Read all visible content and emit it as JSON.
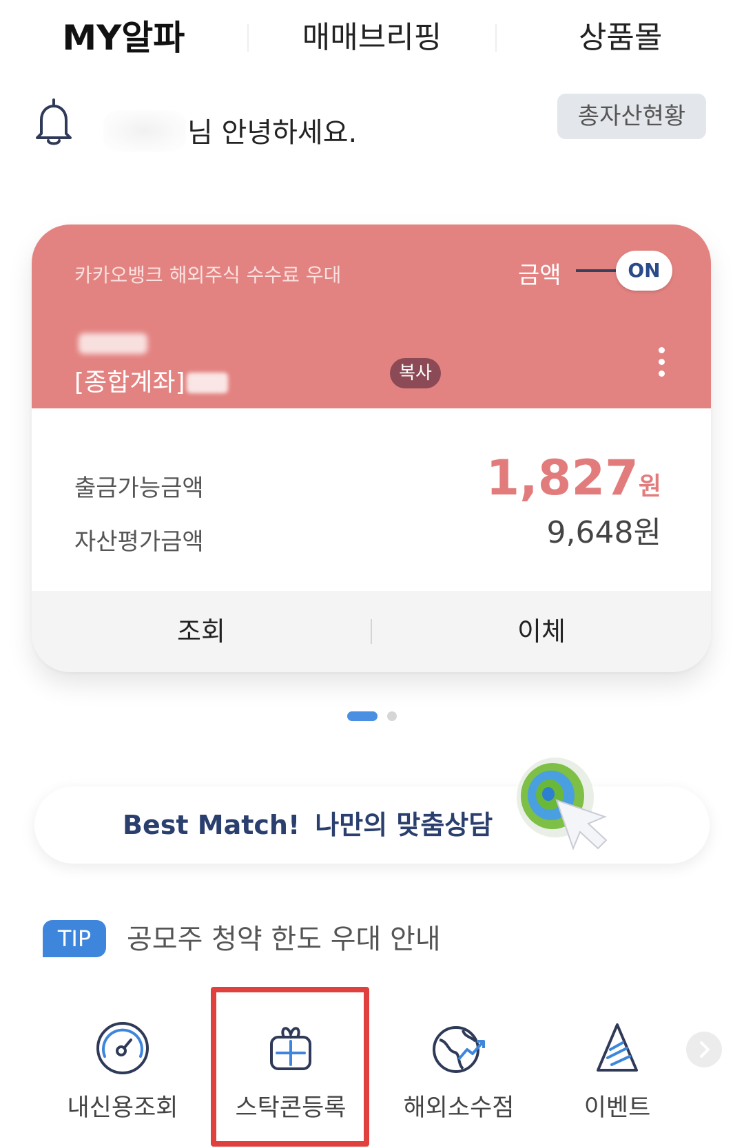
{
  "tabs": [
    {
      "label": "MY알파"
    },
    {
      "label": "매매브리핑"
    },
    {
      "label": "상품몰"
    }
  ],
  "greeting": {
    "text": "님 안녕하세요.",
    "total_asset_button": "총자산현황"
  },
  "account_card": {
    "promo": "카카오뱅크 해외주식 수수료 우대",
    "amount_toggle_label": "금액",
    "toggle_state": "ON",
    "account_type": "[종합계좌]",
    "copy_button": "복사",
    "available_label": "출금가능금액",
    "available_value": "1,827",
    "available_unit": "원",
    "asset_label": "자산평가금액",
    "asset_value": "9,648원",
    "inquiry_button": "조회",
    "transfer_button": "이체",
    "accent_color": "#e38381"
  },
  "pager": {
    "current": 1,
    "total": 2
  },
  "banner": {
    "en": "Best Match!",
    "kr": "나만의 맞춤상담"
  },
  "tip": {
    "badge": "TIP",
    "text": "공모주 청약 한도 우대 안내"
  },
  "quick_menu": [
    {
      "label": "내신용조회",
      "icon": "gauge-icon"
    },
    {
      "label": "스탁콘등록",
      "icon": "gift-icon"
    },
    {
      "label": "해외소수점",
      "icon": "globe-chart-icon"
    },
    {
      "label": "이벤트",
      "icon": "party-hat-icon"
    }
  ]
}
